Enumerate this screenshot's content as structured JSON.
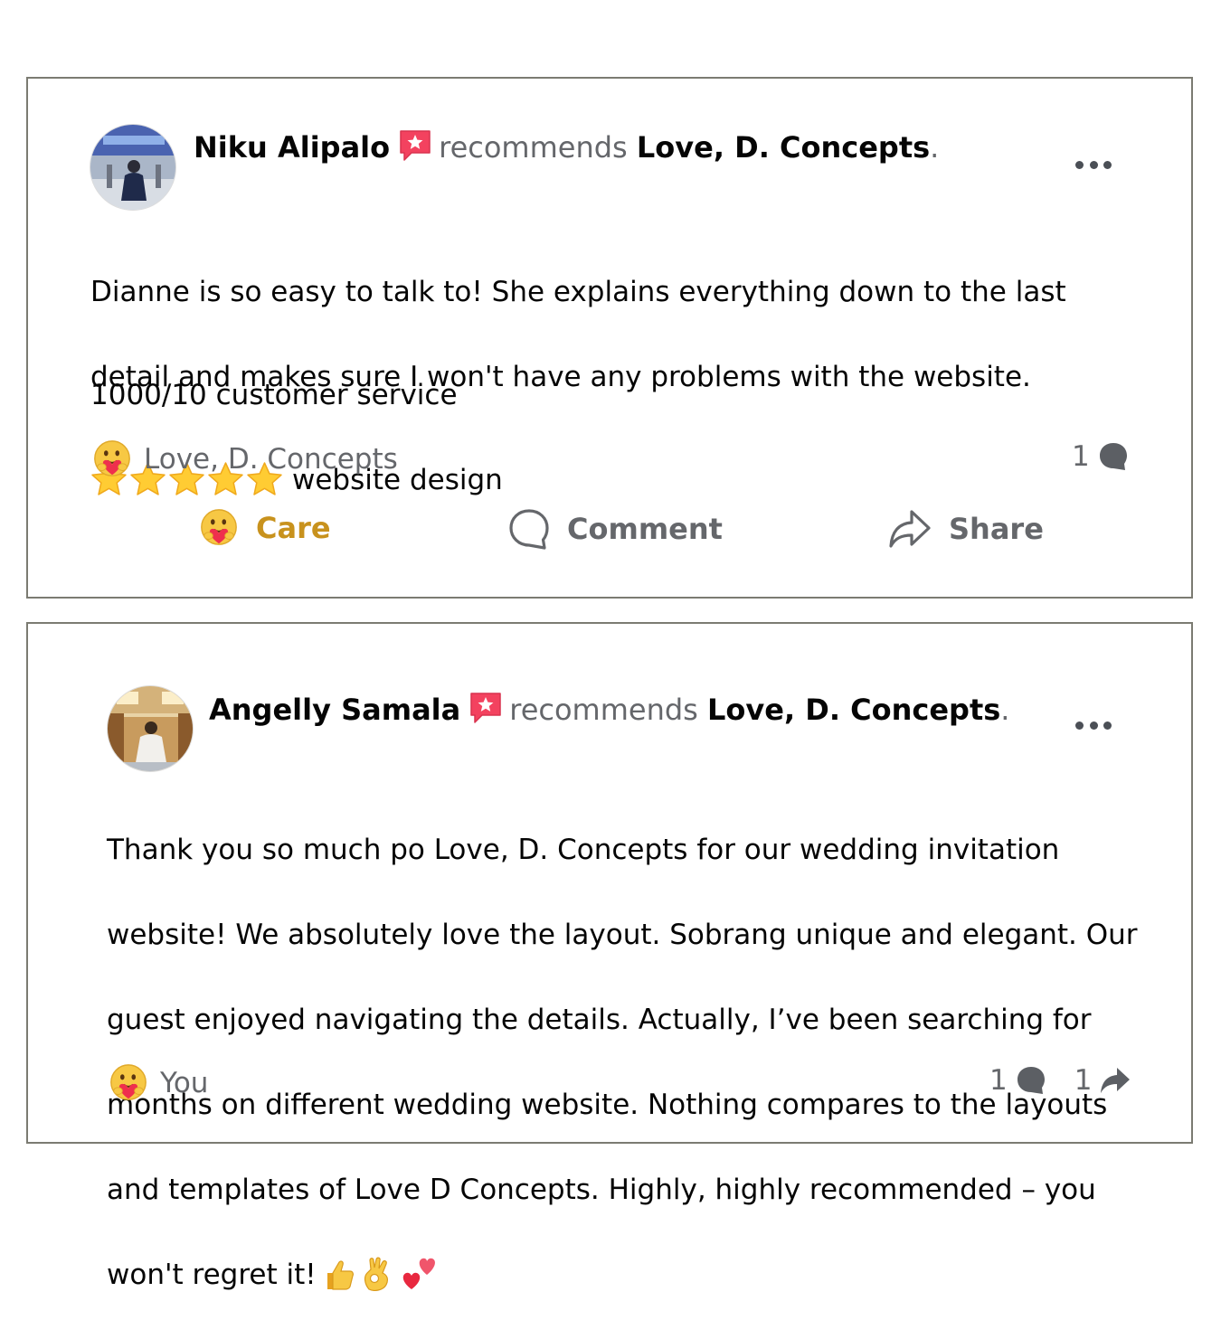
{
  "posts": [
    {
      "author": "Niku Alipalo",
      "recommends": "recommends",
      "page": "Love, D. Concepts",
      "period": ".",
      "lines": [
        "Dianne is so easy to talk to! She explains everything down to the last",
        "detail and makes sure I won't have any problems with the website."
      ],
      "line3": "1000/10 customer service",
      "star_count": 5,
      "line4": "website design",
      "reactor": "Love, D. Concepts",
      "comment_count": "1",
      "actions": {
        "care": "Care",
        "comment": "Comment",
        "share": "Share"
      }
    },
    {
      "author": "Angelly Samala",
      "recommends": "recommends",
      "page": "Love, D. Concepts",
      "period": ".",
      "lines": [
        "Thank you so much po Love, D. Concepts for our wedding invitation",
        "website! We absolutely love the layout. Sobrang unique and elegant. Our",
        "guest enjoyed navigating the details. Actually, I’ve been searching for",
        "months on different wedding website. Nothing compares to the layouts",
        "and templates of Love D Concepts. Highly, highly recommended – you",
        "won't regret it!"
      ],
      "emojis": [
        "thumbs-up",
        "ok-hand",
        "two-hearts"
      ],
      "reactor": "You",
      "comment_count": "1",
      "share_count": "1"
    }
  ],
  "colors": {
    "accent_care": "#c8921d",
    "secondary_text": "#65676b",
    "badge_pink": "#f3425f",
    "border": "#7b7b72"
  }
}
